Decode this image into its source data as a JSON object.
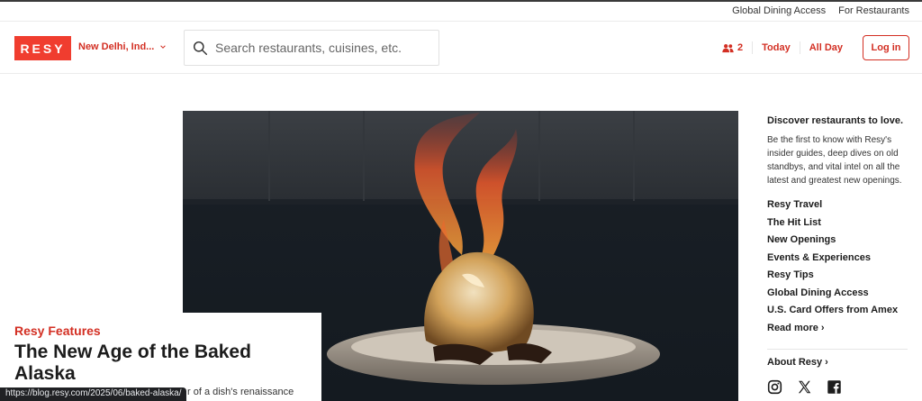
{
  "utility": {
    "global_dining": "Global Dining Access",
    "for_restaurants": "For Restaurants"
  },
  "header": {
    "logo": "RESY",
    "location": "New Delhi, Ind...",
    "search_placeholder": "Search restaurants, cuisines, etc.",
    "party_size": "2",
    "date": "Today",
    "time": "All Day",
    "login": "Log in"
  },
  "feature": {
    "kicker": "Resy Features",
    "headline": "The New Age of the Baked Alaska",
    "dek_partial": "r of a dish's renaissance"
  },
  "status_url": "https://blog.resy.com/2025/06/baked-alaska/",
  "sidebar": {
    "title": "Discover restaurants to love.",
    "description": "Be the first to know with Resy's insider guides, deep dives on old standbys, and vital intel on all the latest and greatest new openings.",
    "links": [
      "Resy Travel",
      "The Hit List",
      "New Openings",
      "Events & Experiences",
      "Resy Tips",
      "Global Dining Access",
      "U.S. Card Offers from Amex",
      "Read more ›"
    ],
    "about": "About Resy ›"
  },
  "colors": {
    "brand": "#f03d2f",
    "accent_text": "#d32f23"
  },
  "icons": {
    "search": "search-icon",
    "party": "people-icon",
    "instagram": "instagram-icon",
    "x": "x-icon",
    "facebook": "facebook-icon"
  }
}
